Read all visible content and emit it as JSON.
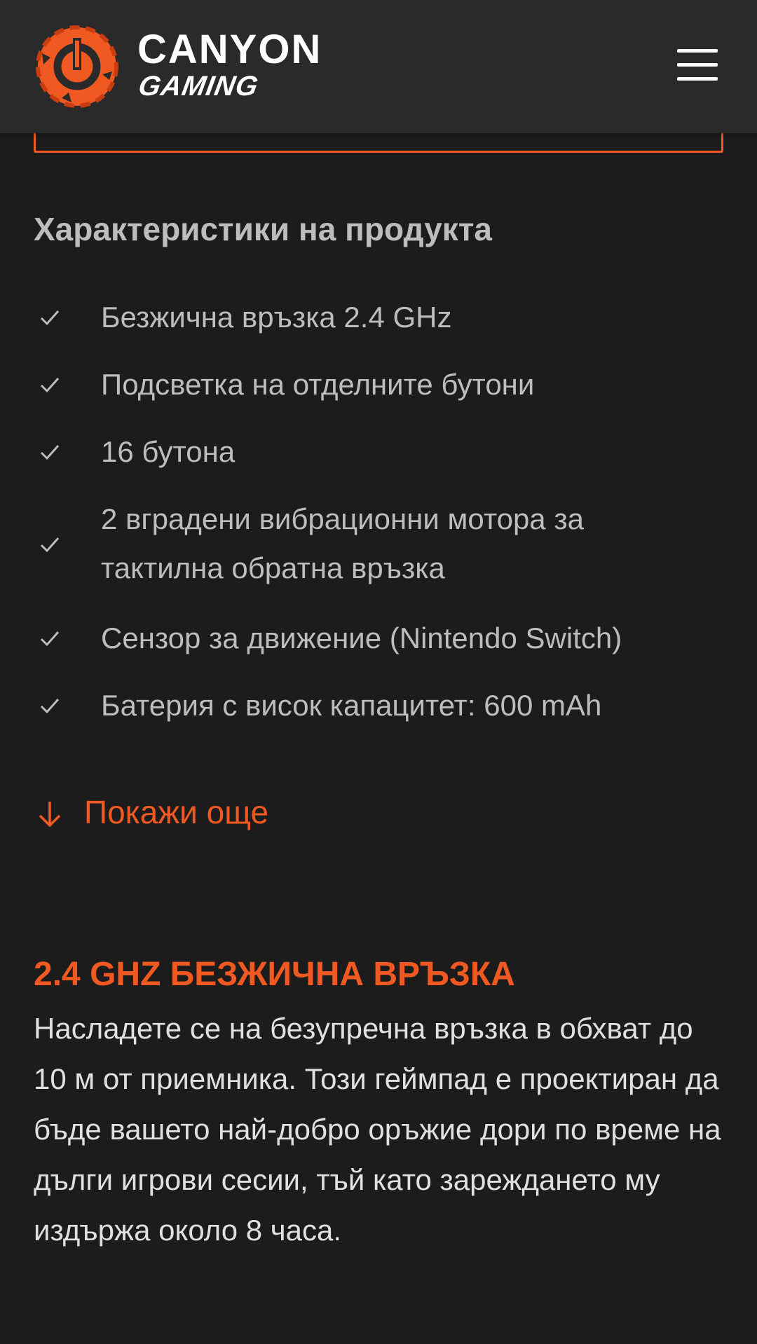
{
  "header": {
    "brand_top": "CANYON",
    "brand_bottom": "GAMING",
    "logo_icon": "canyon-gaming-logo-icon",
    "menu_icon": "hamburger-menu-icon",
    "accent_color": "#f05a22"
  },
  "features": {
    "title": "Характеристики на продукта",
    "check_icon": "check-icon",
    "items": [
      "Безжична връзка 2.4 GHz",
      "Подсветка на отделните бутони",
      "16 бутона",
      "2 вградени вибрационни мотора за тактилна обратна връзка",
      "Сензор за движение (Nintendo Switch)",
      "Батерия с висок капацитет: 600 mAh"
    ],
    "show_more_label": "Покажи още",
    "show_more_icon": "arrow-down-icon"
  },
  "promo": {
    "title": "2.4 GHZ БЕЗЖИЧНА ВРЪЗКА",
    "text": "Насладете се на безупречна връзка в обхват до 10 м от приемника. Този геймпад е проектиран да бъде вашето най-добро оръжие дори по време на дълги игрови сесии, тъй като зареждането му издържа около 8 часа."
  }
}
